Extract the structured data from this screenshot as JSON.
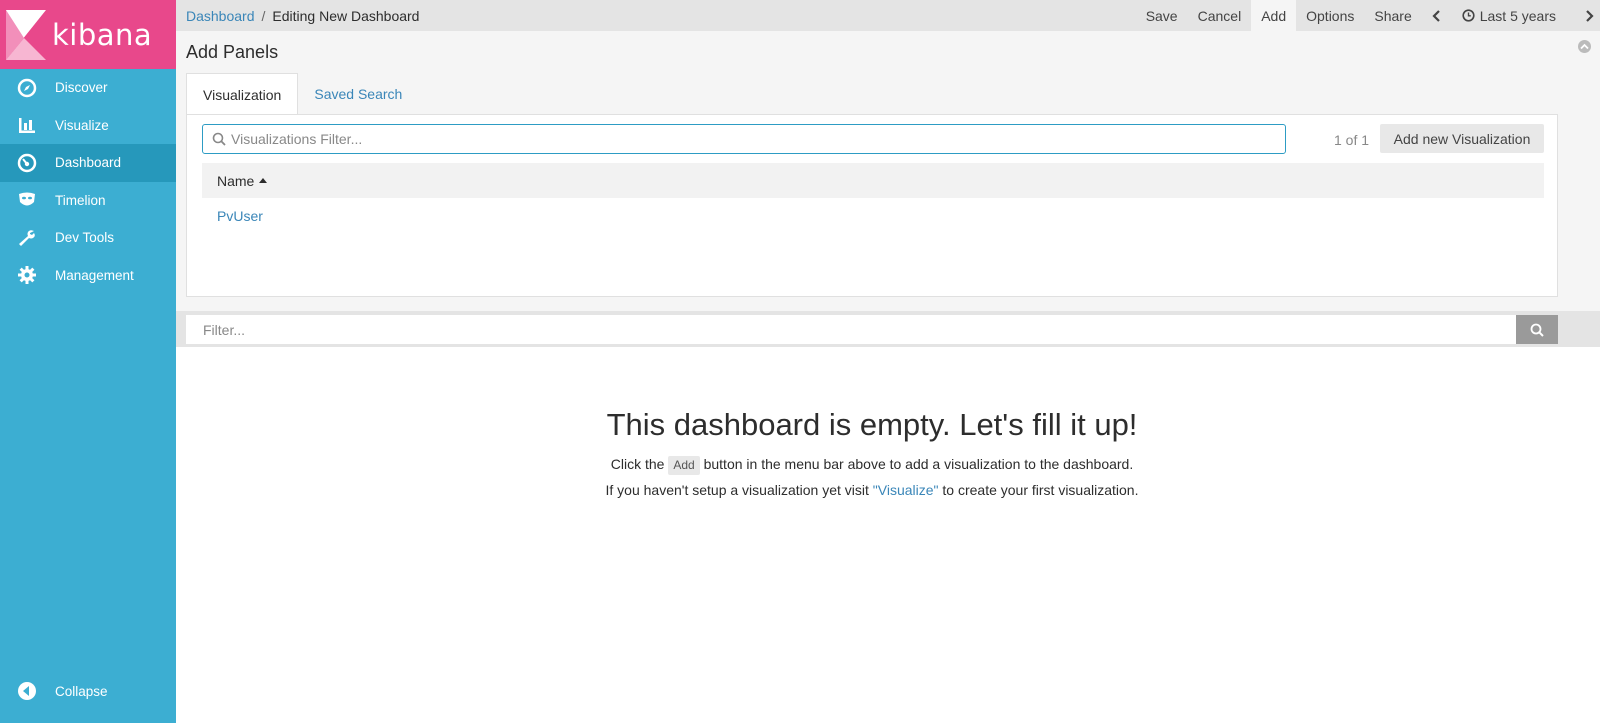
{
  "brand": {
    "name": "kibana",
    "color": "#e8488b"
  },
  "sidebar": {
    "items": [
      {
        "label": "Discover",
        "icon": "compass-icon"
      },
      {
        "label": "Visualize",
        "icon": "bar-chart-icon"
      },
      {
        "label": "Dashboard",
        "icon": "dashboard-gauge-icon",
        "active": true
      },
      {
        "label": "Timelion",
        "icon": "timelion-mask-icon"
      },
      {
        "label": "Dev Tools",
        "icon": "wrench-icon"
      },
      {
        "label": "Management",
        "icon": "gear-icon"
      }
    ],
    "collapse_label": "Collapse"
  },
  "breadcrumb": {
    "parent": "Dashboard",
    "separator": "/",
    "current": "Editing New Dashboard"
  },
  "menu": {
    "save": "Save",
    "cancel": "Cancel",
    "add": "Add",
    "options": "Options",
    "share": "Share",
    "time_range": "Last 5 years"
  },
  "add_panels": {
    "title": "Add Panels",
    "tabs": [
      "Visualization",
      "Saved Search"
    ],
    "search_placeholder": "Visualizations Filter...",
    "count": "1 of 1",
    "add_button": "Add new Visualization",
    "column_header": "Name",
    "rows": [
      "PvUser"
    ]
  },
  "filter": {
    "placeholder": "Filter..."
  },
  "empty_state": {
    "title": "This dashboard is empty. Let's fill it up!",
    "line1_before": "Click the",
    "line1_kbd": "Add",
    "line1_after": "button in the menu bar above to add a visualization to the dashboard.",
    "line2_before": "If you haven't setup a visualization yet visit",
    "line2_link": "\"Visualize\"",
    "line2_after": "to create your first visualization."
  }
}
